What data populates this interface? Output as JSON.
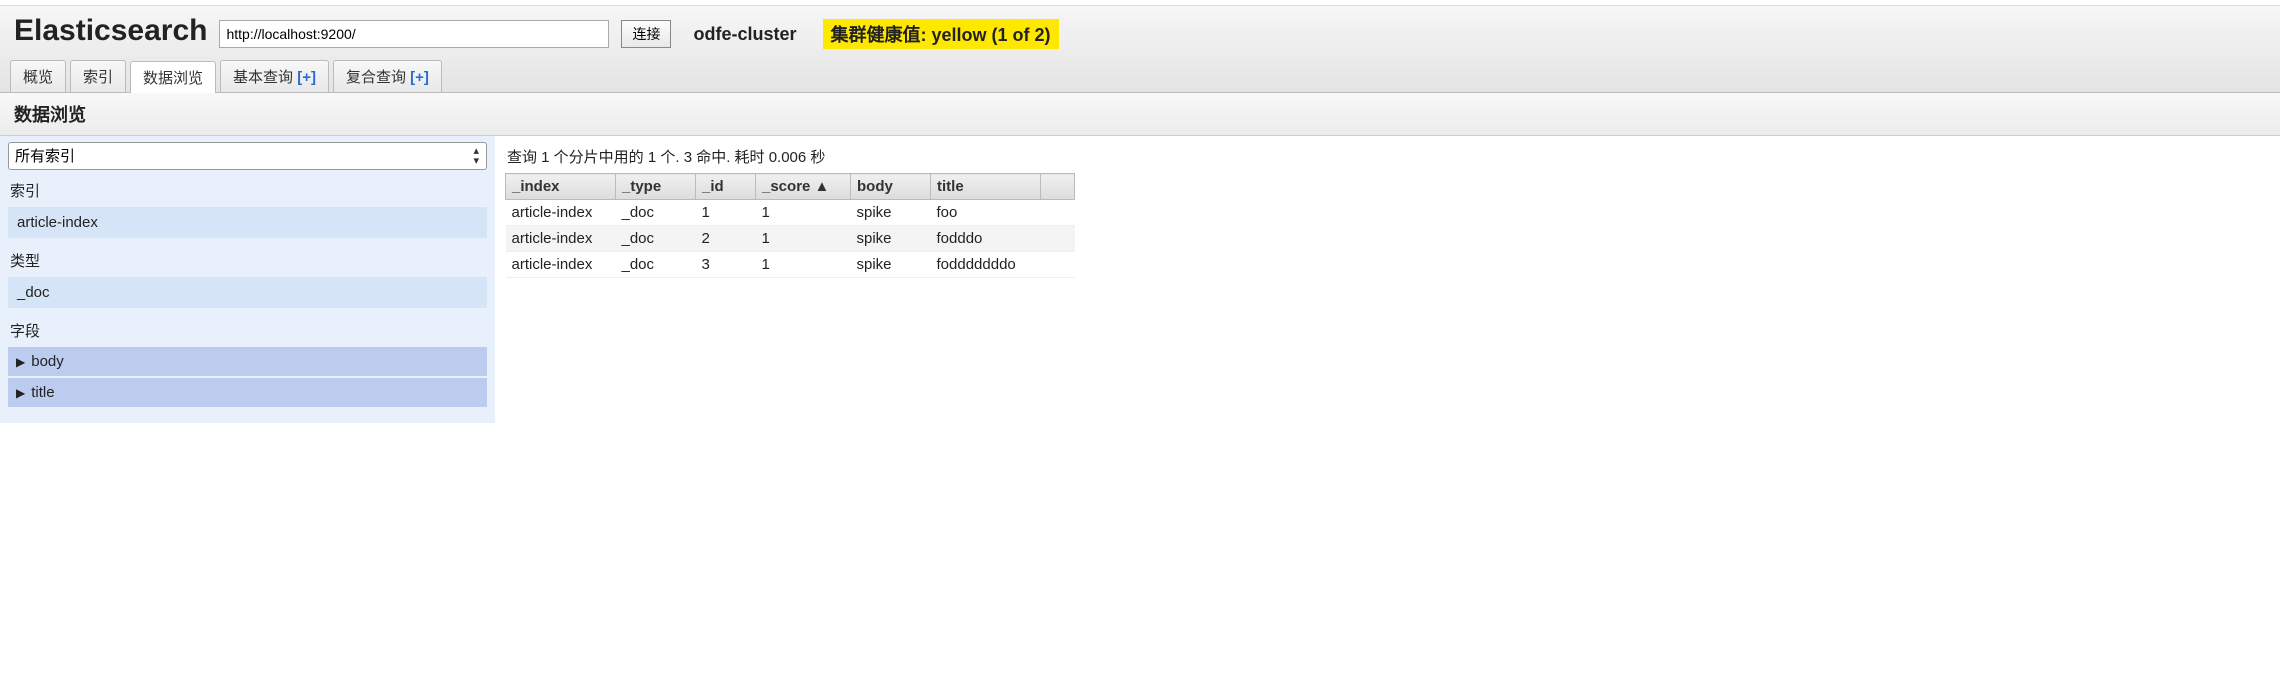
{
  "app_title": "Elasticsearch",
  "address": "http://localhost:9200/",
  "connect_label": "连接",
  "cluster_name": "odfe-cluster",
  "health_text": "集群健康值: yellow (1 of 2)",
  "tabs": {
    "overview": "概览",
    "indices": "索引",
    "browser": "数据浏览",
    "basic_query": "基本查询",
    "basic_query_plus": "[+]",
    "compound_query": "复合查询",
    "compound_query_plus": "[+]"
  },
  "subheader": "数据浏览",
  "sidebar": {
    "all_indices": "所有索引",
    "labels": {
      "index": "索引",
      "type": "类型",
      "fields": "字段"
    },
    "index_items": [
      "article-index"
    ],
    "type_items": [
      "_doc"
    ],
    "field_items": [
      "body",
      "title"
    ]
  },
  "results_info": "查询 1 个分片中用的 1 个. 3 命中. 耗时 0.006 秒",
  "columns": {
    "index": "_index",
    "type": "_type",
    "id": "_id",
    "score": "_score",
    "body": "body",
    "title": "title"
  },
  "sort_indicator": "▲",
  "rows": [
    {
      "index": "article-index",
      "type": "_doc",
      "id": "1",
      "score": "1",
      "body": "spike",
      "title": "foo"
    },
    {
      "index": "article-index",
      "type": "_doc",
      "id": "2",
      "score": "1",
      "body": "spike",
      "title": "fodddo"
    },
    {
      "index": "article-index",
      "type": "_doc",
      "id": "3",
      "score": "1",
      "body": "spike",
      "title": "fodddddddo"
    }
  ]
}
